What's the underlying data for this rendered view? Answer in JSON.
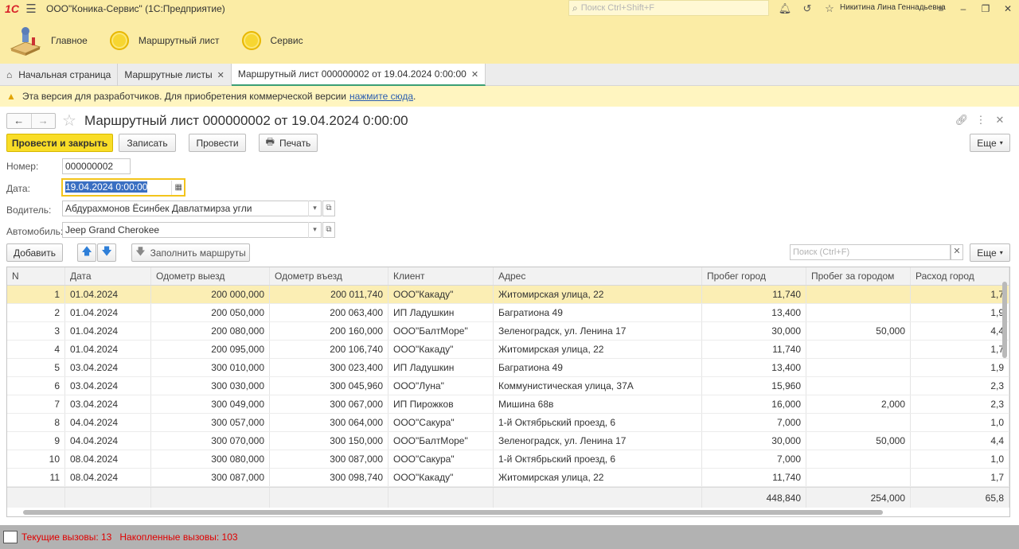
{
  "titlebar": {
    "logo": "1С",
    "title": "ООО\"Коника-Сервис\"  (1С:Предприятие)",
    "search_placeholder": "Поиск Ctrl+Shift+F",
    "user": "Никитина Лина Геннадьевна"
  },
  "sections": [
    {
      "label": "Главное",
      "icon": "home-icon"
    },
    {
      "label": "Маршрутный лист",
      "icon": "circle-icon"
    },
    {
      "label": "Сервис",
      "icon": "circle-icon"
    }
  ],
  "tabs": [
    {
      "label": "Начальная страница"
    },
    {
      "label": "Маршрутные листы"
    },
    {
      "label": "Маршрутный лист 000000002 от 19.04.2024 0:00:00"
    }
  ],
  "warning": {
    "text": "Эта версия для разработчиков. Для приобретения коммерческой версии",
    "link": "нажмите сюда",
    "tail": "."
  },
  "form": {
    "title": "Маршрутный лист 000000002 от 19.04.2024 0:00:00",
    "buttons": {
      "post_close": "Провести и закрыть",
      "save": "Записать",
      "post": "Провести",
      "print": "Печать",
      "more": "Еще"
    },
    "fields": {
      "number_label": "Номер:",
      "number": "000000002",
      "date_label": "Дата:",
      "date": "19.04.2024  0:00:00",
      "driver_label": "Водитель:",
      "driver": "Абдурахмонов Ёсинбек Давлатмирза угли",
      "car_label": "Автомобиль:",
      "car": "Jeep Grand Cherokee"
    }
  },
  "table_toolbar": {
    "add": "Добавить",
    "fill_routes": "Заполнить маршруты",
    "search_placeholder": "Поиск (Ctrl+F)",
    "more": "Еще"
  },
  "table": {
    "columns": [
      "N",
      "Дата",
      "Одометр выезд",
      "Одометр въезд",
      "Клиент",
      "Адрес",
      "Пробег город",
      "Пробег за городом",
      "Расход город"
    ],
    "rows": [
      [
        "1",
        "01.04.2024",
        "200 000,000",
        "200 011,740",
        "ООО\"Какаду\"",
        "Житомирская улица, 22",
        "11,740",
        "",
        "1,7"
      ],
      [
        "2",
        "01.04.2024",
        "200 050,000",
        "200 063,400",
        "ИП Ладушкин",
        "Багратиона 49",
        "13,400",
        "",
        "1,9"
      ],
      [
        "3",
        "01.04.2024",
        "200 080,000",
        "200 160,000",
        "ООО\"БалтМоре\"",
        "Зеленоградск, ул. Ленина 17",
        "30,000",
        "50,000",
        "4,4"
      ],
      [
        "4",
        "01.04.2024",
        "200 095,000",
        "200 106,740",
        "ООО\"Какаду\"",
        "Житомирская улица, 22",
        "11,740",
        "",
        "1,7"
      ],
      [
        "5",
        "03.04.2024",
        "300 010,000",
        "300 023,400",
        "ИП Ладушкин",
        "Багратиона 49",
        "13,400",
        "",
        "1,9"
      ],
      [
        "6",
        "03.04.2024",
        "300 030,000",
        "300 045,960",
        "ООО\"Луна\"",
        "Коммунистическая улица, 37А",
        "15,960",
        "",
        "2,3"
      ],
      [
        "7",
        "03.04.2024",
        "300 049,000",
        "300 067,000",
        "ИП Пирожков",
        "Мишина 68в",
        "16,000",
        "2,000",
        "2,3"
      ],
      [
        "8",
        "04.04.2024",
        "300 057,000",
        "300 064,000",
        "ООО\"Сакура\"",
        "1-й Октябрьский проезд, 6",
        "7,000",
        "",
        "1,0"
      ],
      [
        "9",
        "04.04.2024",
        "300 070,000",
        "300 150,000",
        "ООО\"БалтМоре\"",
        "Зеленоградск, ул. Ленина 17",
        "30,000",
        "50,000",
        "4,4"
      ],
      [
        "10",
        "08.04.2024",
        "300 080,000",
        "300 087,000",
        "ООО\"Сакура\"",
        "1-й Октябрьский проезд, 6",
        "7,000",
        "",
        "1,0"
      ],
      [
        "11",
        "08.04.2024",
        "300 087,000",
        "300 098,740",
        "ООО\"Какаду\"",
        "Житомирская улица, 22",
        "11,740",
        "",
        "1,7"
      ]
    ],
    "totals": [
      "",
      "",
      "",
      "",
      "",
      "",
      "448,840",
      "254,000",
      "65,8"
    ]
  },
  "statusbar": {
    "current_calls": "Текущие вызовы: 13",
    "accumulated_calls": "Накопленные вызовы: 103"
  }
}
